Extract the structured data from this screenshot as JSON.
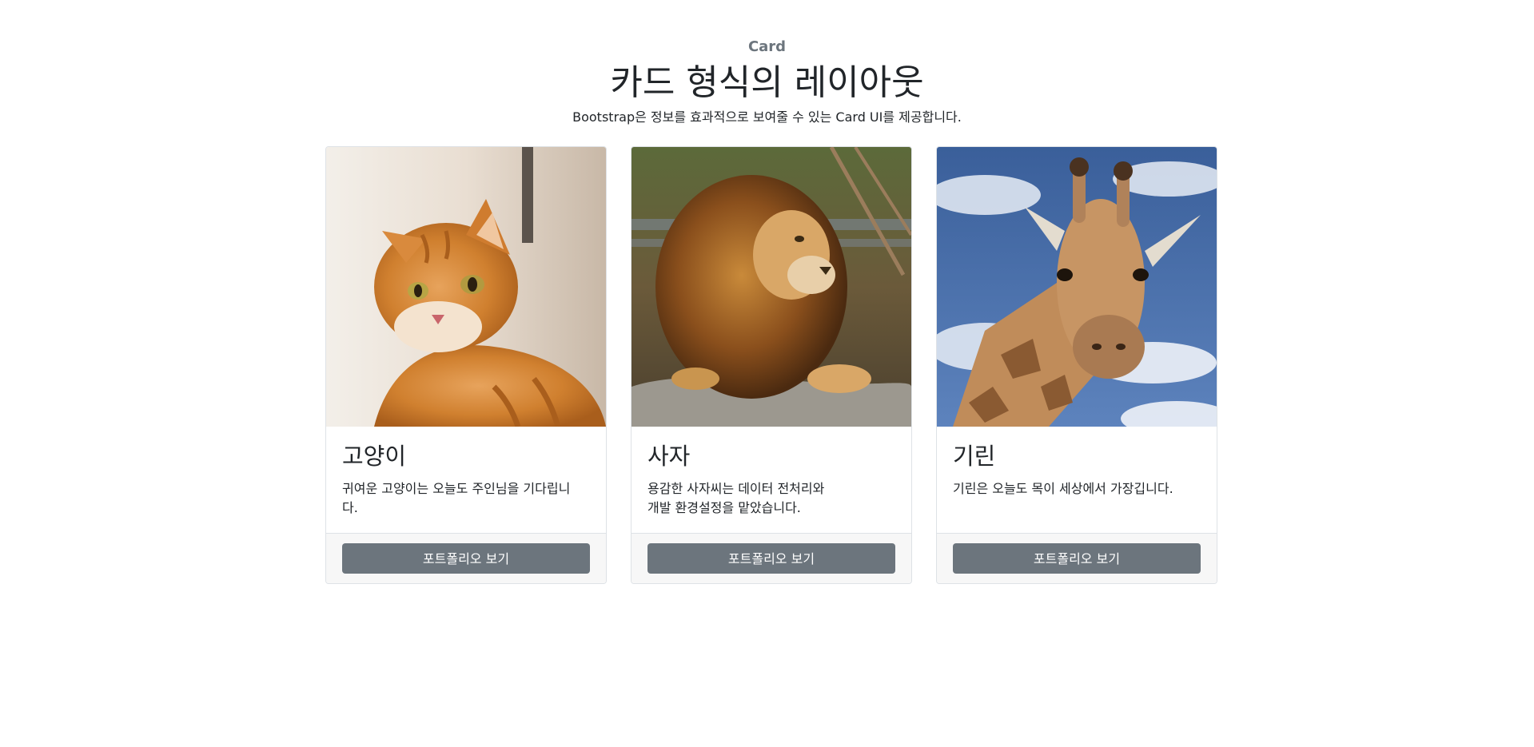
{
  "header": {
    "eyebrow": "Card",
    "title": "카드 형식의 레이아웃",
    "subtitle": "Bootstrap은 정보를 효과적으로 보여줄 수 있는 Card UI를 제공합니다."
  },
  "cards": [
    {
      "title": "고양이",
      "text": "귀여운 고양이는 오늘도 주인님을 기다립니\n다.",
      "button_label": "포트폴리오 보기",
      "image_icon": "cat-photo"
    },
    {
      "title": "사자",
      "text": "용감한 사자씨는 데이터 전처리와\n개발 환경설정을 맡았습니다.",
      "button_label": "포트폴리오 보기",
      "image_icon": "lion-photo"
    },
    {
      "title": "기린",
      "text": "기린은 오늘도 목이 세상에서 가장깁니다.",
      "button_label": "포트폴리오 보기",
      "image_icon": "giraffe-photo"
    }
  ],
  "colors": {
    "button_bg": "#6c757d",
    "footer_bg": "#f7f7f7",
    "eyebrow": "#6c757d"
  }
}
